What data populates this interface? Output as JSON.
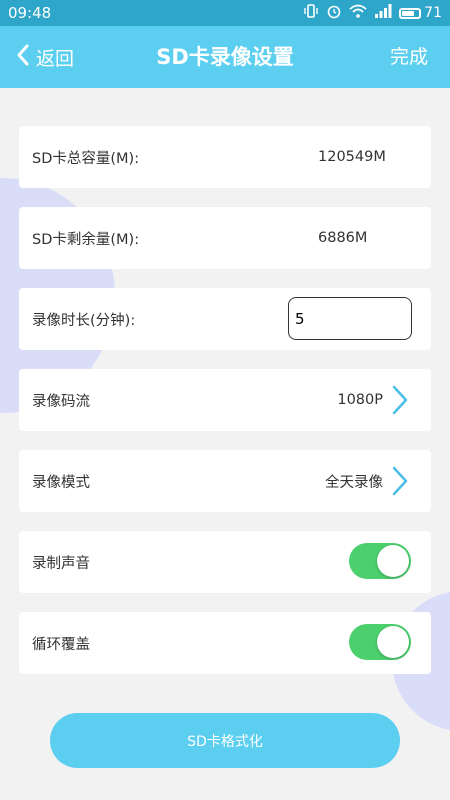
{
  "status_bar": {
    "time": "09:48",
    "battery_level": "71",
    "battery_fraction": 0.71,
    "icons": [
      "vibrate-icon",
      "alarm-icon",
      "wifi-icon",
      "signal-icon",
      "battery-icon"
    ]
  },
  "header": {
    "back_label": "返回",
    "title": "SD卡录像设置",
    "done_label": "完成"
  },
  "settings": {
    "total_capacity": {
      "label": "SD卡总容量(M):",
      "value": "120549M"
    },
    "remaining": {
      "label": "SD卡剩余量(M):",
      "value": "6886M"
    },
    "record_duration": {
      "label": "录像时长(分钟):",
      "value": "5"
    },
    "stream": {
      "label": "录像码流",
      "value": "1080P"
    },
    "mode": {
      "label": "录像模式",
      "value": "全天录像"
    },
    "record_audio": {
      "label": "录制声音",
      "enabled": true
    },
    "loop_overwrite": {
      "label": "循环覆盖",
      "enabled": true
    }
  },
  "format_button": {
    "label": "SD卡格式化"
  },
  "colors": {
    "status_bar": "#2ea6c9",
    "header": "#5ccff0",
    "toggle_on": "#4cd06e",
    "chevron": "#4bbde6",
    "decoration": "#d9ddf8"
  }
}
